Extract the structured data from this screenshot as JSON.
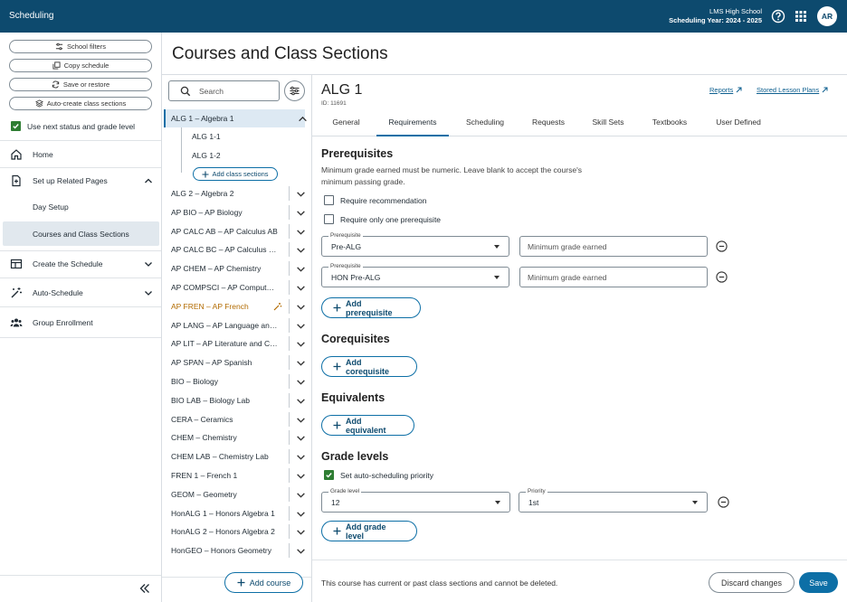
{
  "app": {
    "title": "Scheduling",
    "school_name": "LMS High School",
    "school_year": "Scheduling Year: 2024 - 2025",
    "avatar_initials": "AR"
  },
  "sidebar": {
    "school_filters": "School filters",
    "copy_schedule": "Copy schedule",
    "save_or_restore": "Save or restore",
    "auto_create_sections": "Auto-create class sections",
    "next_status_label": "Use next status and grade level",
    "home": "Home",
    "setup_related_pages": "Set up Related Pages",
    "day_setup": "Day Setup",
    "courses_and_sections": "Courses and Class Sections",
    "create_schedule": "Create the Schedule",
    "auto_schedule": "Auto-Schedule",
    "group_enrollment": "Group Enrollment"
  },
  "page": {
    "title": "Courses and Class Sections"
  },
  "course_list": {
    "search_placeholder": "Search",
    "selected_course": "ALG 1 – Algebra 1",
    "sections": [
      "ALG 1-1",
      "ALG 1-2"
    ],
    "add_sections_label": "Add class sections",
    "courses": [
      "ALG 2 – Algebra 2",
      "AP BIO – AP Biology",
      "AP CALC AB – AP Calculus AB",
      "AP CALC BC – AP Calculus BC",
      "AP CHEM – AP Chemistry",
      "AP COMPSCI – AP Computer Science",
      "AP FREN – AP French",
      "AP LANG – AP Language and Composition",
      "AP LIT – AP Literature and Composition",
      "AP SPAN – AP Spanish",
      "BIO – Biology",
      "BIO LAB – Biology Lab",
      "CERA – Ceramics",
      "CHEM – Chemistry",
      "CHEM LAB – Chemistry Lab",
      "FREN 1 – French 1",
      "GEOM – Geometry",
      "HonALG 1 – Honors Algebra 1",
      "HonALG 2 – Honors Algebra 2",
      "HonGEO – Honors Geometry"
    ],
    "add_course_label": "Add course"
  },
  "detail": {
    "course_code": "ALG 1",
    "course_id": "ID: 11691",
    "reports_link": "Reports",
    "lesson_plans_link": "Stored Lesson Plans",
    "tabs": [
      "General",
      "Requirements",
      "Scheduling",
      "Requests",
      "Skill Sets",
      "Textbooks",
      "User Defined"
    ],
    "prerequisites": {
      "title": "Prerequisites",
      "help": "Minimum grade earned must be numeric. Leave blank to accept the course's minimum passing grade.",
      "require_recommendation": "Require recommendation",
      "require_one": "Require only one prerequisite",
      "field_label": "Prerequisite",
      "grade_placeholder": "Minimum grade earned",
      "items": [
        "Pre-ALG",
        "HON Pre-ALG"
      ],
      "add_label": "Add prerequisite"
    },
    "corequisites": {
      "title": "Corequisites",
      "add_label": "Add corequisite"
    },
    "equivalents": {
      "title": "Equivalents",
      "add_label": "Add equivalent"
    },
    "grade_levels": {
      "title": "Grade levels",
      "auto_priority_label": "Set auto-scheduling priority",
      "grade_label": "Grade level",
      "grade_value": "12",
      "priority_label": "Priority",
      "priority_value": "1st",
      "add_label": "Add grade level"
    },
    "footer_note": "This course has current or past class sections and cannot be deleted.",
    "discard_label": "Discard changes",
    "save_label": "Save"
  },
  "colors": {
    "brand": "#0d4a6e",
    "accent": "#0d6fa6",
    "check": "#2e7d32",
    "warning": "#b26b00"
  }
}
